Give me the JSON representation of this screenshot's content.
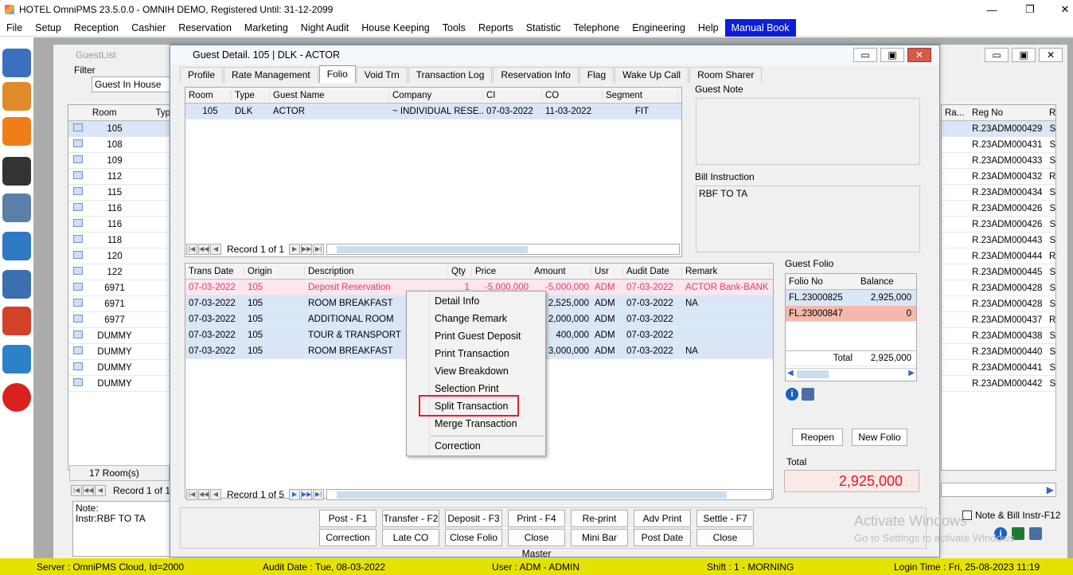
{
  "app": {
    "title": "HOTEL OmniPMS 23.5.0.0 - OMNIH DEMO, Registered Until: 31-12-2099",
    "min": "—",
    "max": "❐",
    "close": "✕"
  },
  "menu": [
    "File",
    "Setup",
    "Reception",
    "Cashier",
    "Reservation",
    "Marketing",
    "Night Audit",
    "House Keeping",
    "Tools",
    "Reports",
    "Statistic",
    "Telephone",
    "Engineering",
    "Help",
    "Manual Book"
  ],
  "sidebar": [
    "notes-icon",
    "guests-icon",
    "map-icon",
    "calendar-icon",
    "database-icon",
    "rooms-available-icon",
    "cart-icon",
    "chart-icon",
    "report-icon",
    "power-icon"
  ],
  "guestlist": {
    "title": "GuestList",
    "filter_label": "Filter",
    "filter_value": "Guest In House",
    "col_room": "Room",
    "col_type": "Typ",
    "col_regno": "Reg No",
    "col_extra": "Ra...",
    "col_s": "R",
    "rooms": [
      "105",
      "108",
      "109",
      "112",
      "115",
      "116",
      "116",
      "118",
      "120",
      "122",
      "6971",
      "6971",
      "6977",
      "DUMMY",
      "DUMMY",
      "DUMMY",
      "DUMMY"
    ],
    "regnos": [
      "R.23ADM000429",
      "R.23ADM000431",
      "R.23ADM000433",
      "R.23ADM000432",
      "R.23ADM000434",
      "R.23ADM000426",
      "R.23ADM000426",
      "R.23ADM000443",
      "R.23ADM000444",
      "R.23ADM000445",
      "R.23ADM000428",
      "R.23ADM000428",
      "R.23ADM000437",
      "R.23ADM000438",
      "R.23ADM000440",
      "R.23ADM000441",
      "R.23ADM000442"
    ],
    "s_col": [
      "S",
      "S",
      "S",
      "R",
      "S",
      "S",
      "S",
      "S",
      "R",
      "S",
      "S",
      "S",
      "R",
      "S",
      "S",
      "S",
      "S"
    ],
    "room_count": "17 Room(s)",
    "record": "Record 1 of 1",
    "note": "Note:",
    "instr": "Instr:RBF TO TA",
    "note_bill": "Note & Bill Instr-F12"
  },
  "detail": {
    "title": "Guest Detail. 105 | DLK - ACTOR",
    "tabs": [
      "Profile",
      "Rate Management",
      "Folio",
      "Void Trn",
      "Transaction Log",
      "Reservation Info",
      "Flag",
      "Wake Up Call",
      "Room Sharer"
    ],
    "active_tab": "Folio",
    "guest_cols": [
      "Room",
      "Type",
      "Guest Name",
      "Company",
      "CI",
      "CO",
      "Segment"
    ],
    "guest_row": [
      "105",
      "DLK",
      "ACTOR",
      "~ INDIVIDUAL RESE...",
      "07-03-2022",
      "11-03-2022",
      "FIT"
    ],
    "guest_record": "Record 1 of 1",
    "guest_note_label": "Guest Note",
    "bill_instr_label": "Bill Instruction",
    "bill_instr": "RBF TO TA",
    "trans_cols": [
      "Trans Date",
      "Origin",
      "Description",
      "Qty",
      "Price",
      "Amount",
      "Usr",
      "Audit Date",
      "Remark"
    ],
    "trans_rows": [
      [
        "07-03-2022",
        "105",
        "Deposit Reservation",
        "1",
        "-5,000,000",
        "-5,000,000",
        "ADM",
        "07-03-2022",
        "ACTOR Bank-BANK B"
      ],
      [
        "07-03-2022",
        "105",
        "ROOM BREAKFAST",
        "",
        "",
        "2,525,000",
        "ADM",
        "07-03-2022",
        "NA"
      ],
      [
        "07-03-2022",
        "105",
        "ADDITIONAL ROOM",
        "",
        "",
        "2,000,000",
        "ADM",
        "07-03-2022",
        ""
      ],
      [
        "07-03-2022",
        "105",
        "TOUR & TRANSPORT",
        "",
        "",
        "400,000",
        "ADM",
        "07-03-2022",
        ""
      ],
      [
        "07-03-2022",
        "105",
        "ROOM BREAKFAST",
        "",
        "",
        "3,000,000",
        "ADM",
        "07-03-2022",
        "NA"
      ]
    ],
    "trans_record": "Record 1 of 5",
    "folio_label": "Guest Folio",
    "folio_cols": [
      "Folio No",
      "Balance"
    ],
    "folios": [
      [
        "FL.23000825",
        "2,925,000"
      ],
      [
        "FL.23000847",
        "0"
      ]
    ],
    "folio_total_label": "Total",
    "folio_total": "2,925,000",
    "reopen": "Reopen",
    "new_folio": "New Folio",
    "total_label": "Total",
    "total_value": "2,925,000",
    "buttons_row1": [
      "Post - F1",
      "Transfer - F2",
      "Deposit - F3",
      "Print - F4",
      "Re-print",
      "Adv Print",
      "Settle - F7"
    ],
    "buttons_row2": [
      "Correction",
      "Late CO",
      "Close Folio",
      "Close Master",
      "Mini Bar",
      "Post Date",
      "Close"
    ]
  },
  "context_menu": [
    "Detail Info",
    "Change Remark",
    "Print Guest Deposit",
    "Print Transaction",
    "View Breakdown",
    "Selection Print",
    "Split Transaction",
    "Merge Transaction",
    "Correction"
  ],
  "watermark": {
    "line1": "Activate Windows",
    "line2": "Go to Settings to activate Windows."
  },
  "status": {
    "server": "Server : OmniPMS Cloud, Id=2000",
    "audit": "Audit Date : Tue, 08-03-2022",
    "user": "User : ADM - ADMIN",
    "shift": "Shift : 1 - MORNING",
    "login": "Login Time : Fri, 25-08-2023 11:19"
  }
}
